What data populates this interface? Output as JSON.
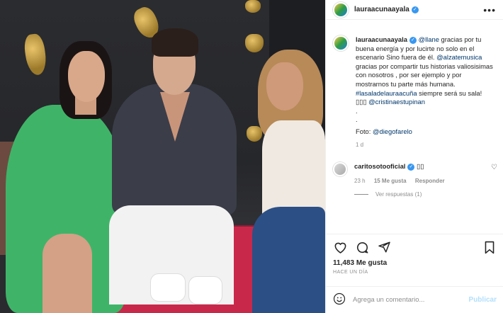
{
  "post": {
    "username": "lauraacunaayala",
    "more_icon": "more-horizontal-icon"
  },
  "caption": {
    "username": "lauraacunaayala",
    "mention1": "@llane",
    "text1": " gracias por tu buena energía y por lucirte no solo en el escenario Sino fuera de él.",
    "mention2": "@alzatemusica",
    "text2": " gracias por compartir tus historias valiosisimas con nosotros , por ser ejemplo y por mostrarnos tu parte más humana.",
    "hashtag": "#lasaladelauraacuña",
    "text3": " siempre será su sala! ",
    "emoji": "▯▯▯",
    "mention3": "@cristinaestupinan",
    "dot1": ".",
    "dot2": ".",
    "photo_label": "Foto: ",
    "mention4": "@diegofarelo",
    "age": "1 d"
  },
  "reply": {
    "username": "caritosotooficial",
    "text": "▯▯",
    "age": "23 h",
    "likes": "15 Me gusta",
    "reply_label": "Responder",
    "view_replies": "Ver respuestas (1)"
  },
  "actions": {
    "likes": "11,483 Me gusta",
    "time": "HACE UN DÍA"
  },
  "comment_box": {
    "placeholder": "Agrega un comentario...",
    "publish_label": "Publicar"
  },
  "colors": {
    "verified": "#3897f0",
    "link": "#00376b",
    "muted": "#8e8e8e",
    "publish_disabled": "#b2dffc"
  }
}
